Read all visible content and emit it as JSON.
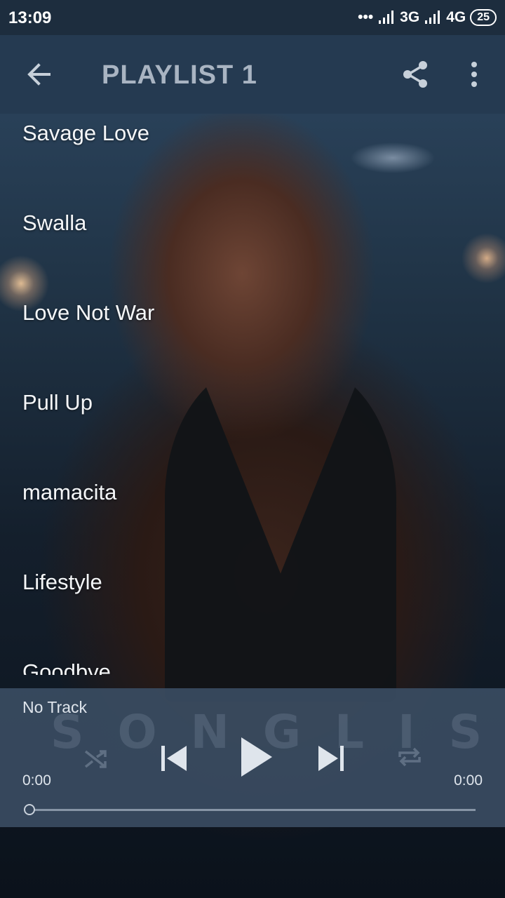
{
  "status_bar": {
    "time": "13:09",
    "network_1": "3G",
    "network_2": "4G",
    "battery": "25"
  },
  "header": {
    "title": "PLAYLIST 1"
  },
  "tracks": [
    "Savage Love",
    "Swalla",
    "Love Not War",
    "Pull Up",
    "mamacita",
    "Lifestyle",
    "Goodbye"
  ],
  "player": {
    "track_name": "No Track",
    "watermark": "SONGLIST",
    "elapsed": "0:00",
    "duration": "0:00",
    "progress": 0
  },
  "icons": {
    "back": "arrow-left-icon",
    "share": "share-icon",
    "more": "more-vertical-icon",
    "shuffle": "shuffle-icon",
    "previous": "skip-previous-icon",
    "play": "play-icon",
    "next": "skip-next-icon",
    "repeat": "repeat-icon"
  },
  "colors": {
    "app_bar": "#253a51",
    "status_bar": "#1d2d3e",
    "player_panel": "#3a4c62",
    "title_text": "#a9b4c2"
  }
}
